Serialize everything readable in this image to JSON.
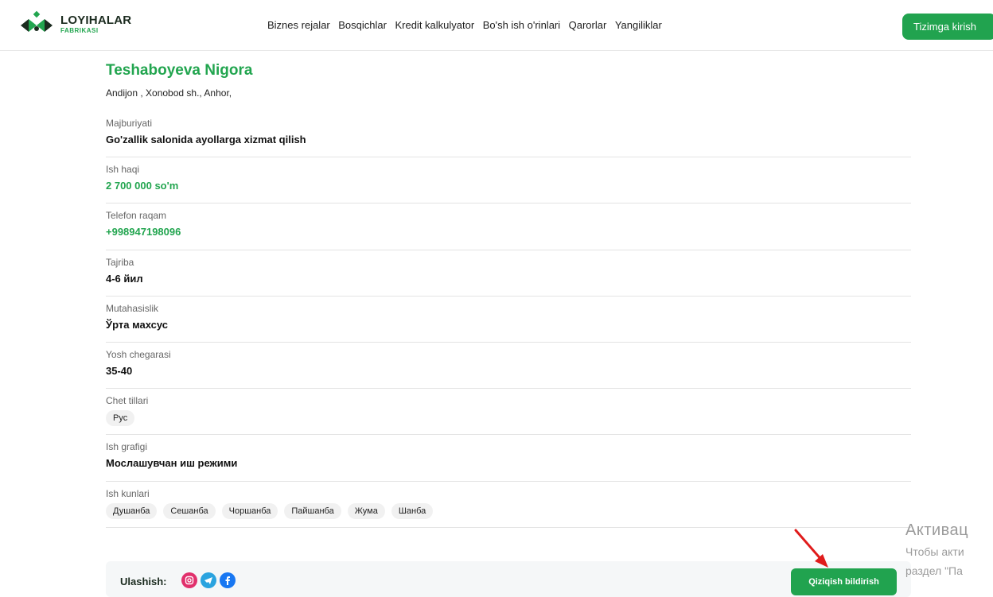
{
  "header": {
    "logo_main": "LOYIHALAR",
    "logo_sub": "FABRIKASI",
    "nav": [
      "Biznes rejalar",
      "Bosqichlar",
      "Kredit kalkulyator",
      "Bo'sh ish o'rinlari",
      "Qarorlar",
      "Yangiliklar"
    ],
    "login_label": "Tizimga kirish"
  },
  "profile": {
    "name": "Teshaboyeva Nigora",
    "address": "Andijon , Xonobod sh., Anhor,",
    "fields": [
      {
        "label": "Majburiyati",
        "value": "Go'zallik salonida ayollarga xizmat qilish"
      },
      {
        "label": "Ish haqi",
        "value": "2 700 000 so'm"
      },
      {
        "label": "Telefon raqam",
        "value": "+998947198096"
      },
      {
        "label": "Tajriba",
        "value": "4-6 йил"
      },
      {
        "label": "Mutahasislik",
        "value": "Ўрта махсус"
      },
      {
        "label": "Yosh chegarasi",
        "value": "35-40"
      },
      {
        "label": "Chet tillari",
        "chips": [
          "Рус"
        ]
      },
      {
        "label": "Ish grafigi",
        "value": "Мослашувчан иш режими"
      },
      {
        "label": "Ish kunlari",
        "chips": [
          "Душанба",
          "Сешанба",
          "Чоршанба",
          "Пайшанба",
          "Жума",
          "Шанба"
        ]
      }
    ]
  },
  "share": {
    "label": "Ulashish:",
    "icons": [
      "instagram-icon",
      "telegram-icon",
      "facebook-icon"
    ]
  },
  "interest_button": "Qiziqish bildirish",
  "watermark": {
    "title": "Активац",
    "line1": "Чтобы акти",
    "line2": "раздел \"Па"
  },
  "colors": {
    "brand_green": "#21a34f",
    "annotation_red": "#e01b1b"
  }
}
